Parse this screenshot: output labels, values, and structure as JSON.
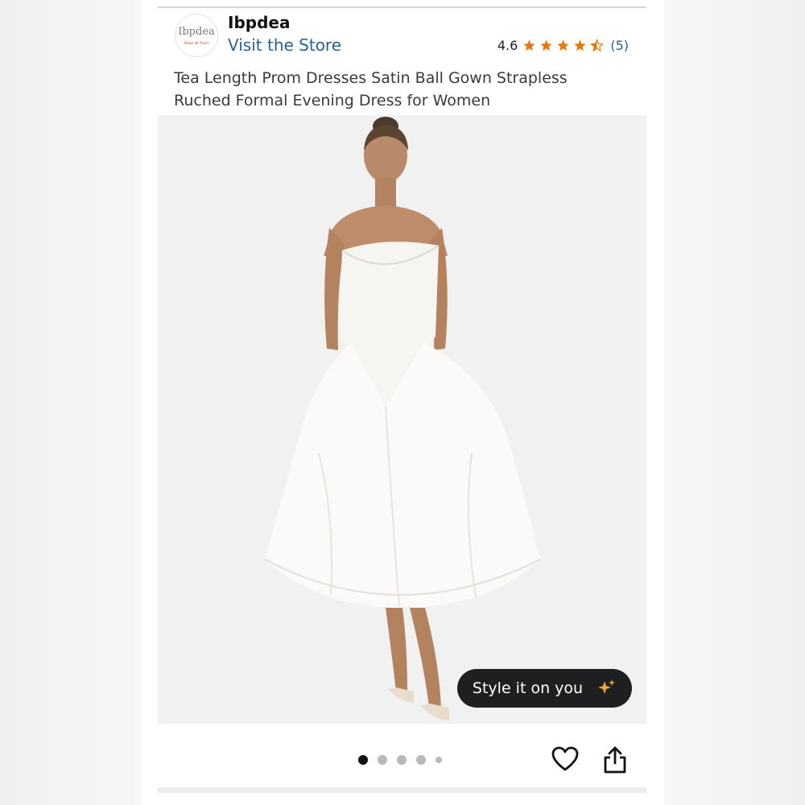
{
  "store": {
    "logo_text": "Ibpdea",
    "logo_tagline": "Dress de Trend",
    "name": "Ibpdea",
    "link_label": "Visit the Store"
  },
  "rating": {
    "value": "4.6",
    "stars": 4.6,
    "count_label": "(5)",
    "star_color": "#e47911"
  },
  "product": {
    "title": "Tea Length Prom Dresses Satin Ball Gown Strapless Ruched Formal Evening Dress for Women",
    "image_subject": "woman-in-white-strapless-tea-length-ball-gown"
  },
  "overlay": {
    "style_button_label": "Style it on you",
    "sparkle_icon": "sparkle-icon"
  },
  "carousel": {
    "total_dots": 5,
    "active_index": 0
  },
  "actions": {
    "favorite_icon": "heart-icon",
    "share_icon": "share-icon"
  },
  "colors": {
    "link": "#2a6190",
    "button_bg": "#1e1f20",
    "image_bg": "#f1f1f1"
  }
}
